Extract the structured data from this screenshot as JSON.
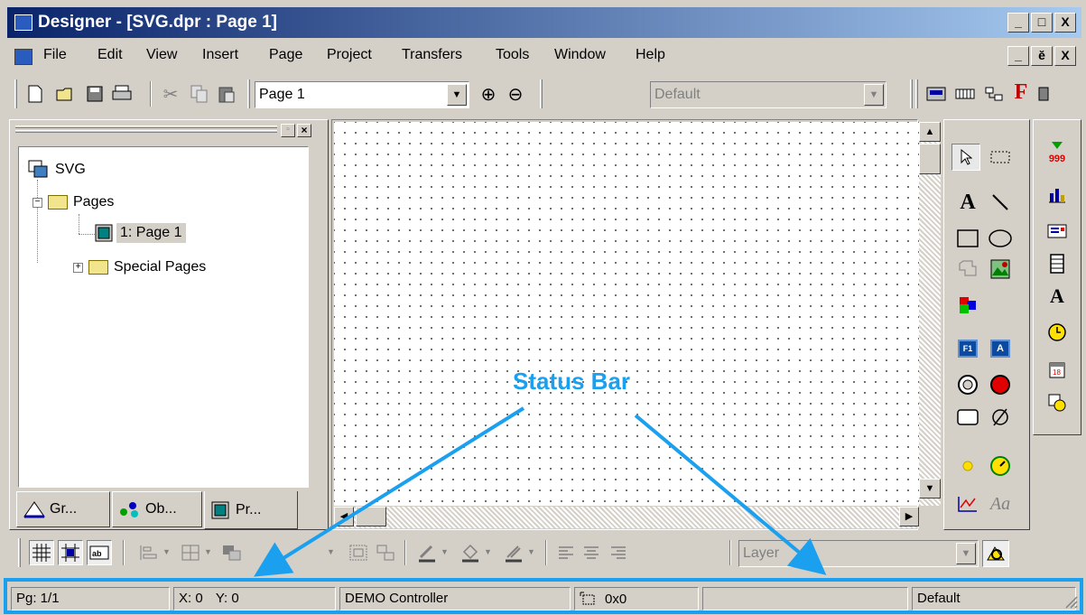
{
  "window": {
    "title": "Designer - [SVG.dpr : Page 1]",
    "caption_buttons": [
      "_",
      "□",
      "X"
    ],
    "child_buttons": [
      "_",
      "ĕ",
      "X"
    ]
  },
  "menu": [
    "File",
    "Edit",
    "View",
    "Insert",
    "Page",
    "Project",
    "Transfers",
    "Tools",
    "Window",
    "Help"
  ],
  "toolbar": {
    "page_combo": "Page 1",
    "style_combo": "Default",
    "zoom_in": "⊕",
    "zoom_out": "⊖",
    "f_icon": "F"
  },
  "tree": {
    "root": "SVG",
    "pages": "Pages",
    "page1": "1: Page 1",
    "special": "Special Pages"
  },
  "tabs": [
    "Gr...",
    "Ob...",
    "Pr..."
  ],
  "toolbox": {
    "text_tool": "A",
    "f1": "F1",
    "a_btn": "A",
    "aa": "Aa",
    "counter": "999",
    "font_tool": "A"
  },
  "bottombar": {
    "layer_combo": "Layer"
  },
  "annotation": "Status Bar",
  "status": {
    "page": "Pg: 1/1",
    "x": "X: 0",
    "y": "Y: 0",
    "controller": "DEMO Controller",
    "size": "0x0",
    "empty": "",
    "style": "Default"
  },
  "colors": {
    "annotation": "#1ba0f0",
    "title_start": "#0a246a",
    "title_end": "#a6caf0"
  }
}
